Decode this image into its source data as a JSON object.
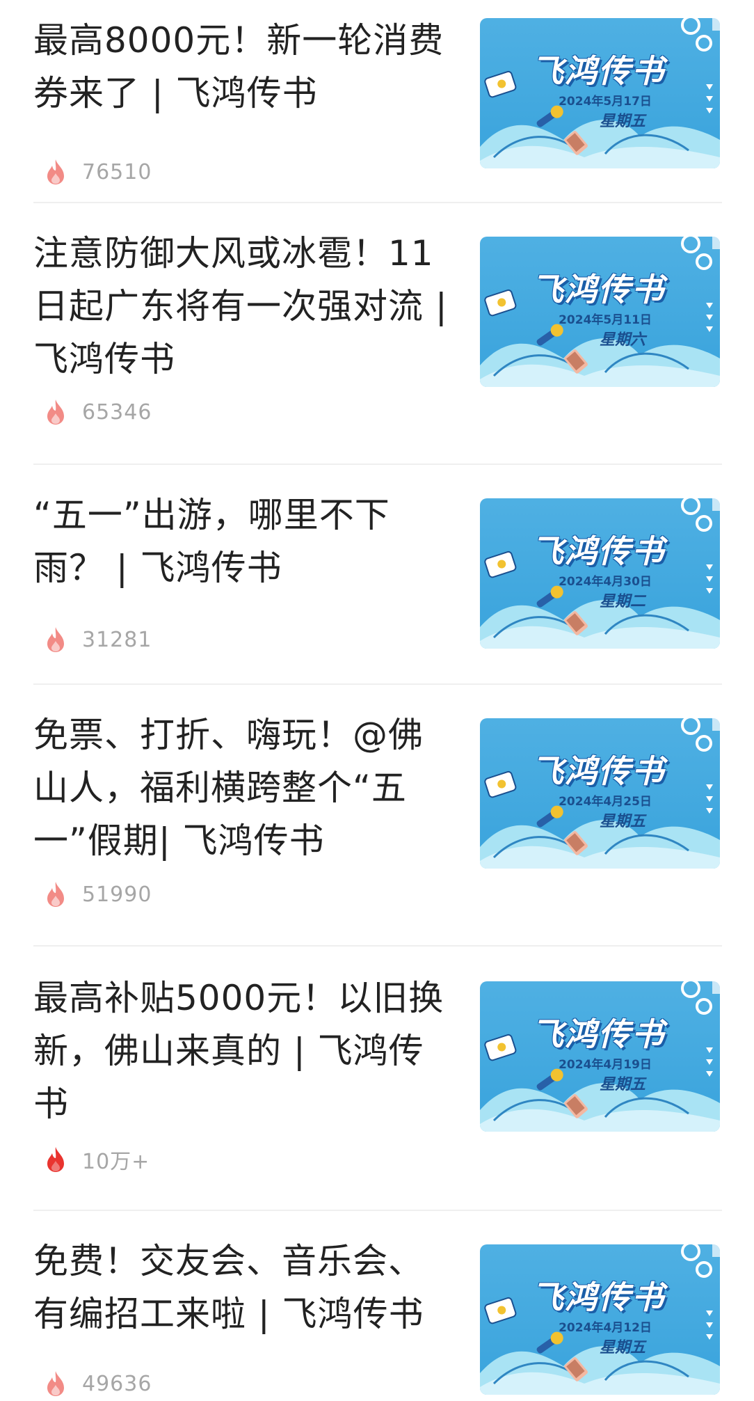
{
  "articles": [
    {
      "title": "最高8000元！新一轮消费券来了 | 飞鸿传书",
      "views": "76510",
      "hot": false,
      "thumb": {
        "brand": "飞鸿传书",
        "date": "2024年5月17日",
        "weekday": "星期五"
      }
    },
    {
      "title": "注意防御大风或冰雹！11日起广东将有一次强对流 | 飞鸿传书",
      "views": "65346",
      "hot": false,
      "thumb": {
        "brand": "飞鸿传书",
        "date": "2024年5月11日",
        "weekday": "星期六"
      }
    },
    {
      "title": "“五一”出游，哪里不下雨？ | 飞鸿传书",
      "views": "31281",
      "hot": false,
      "thumb": {
        "brand": "飞鸿传书",
        "date": "2024年4月30日",
        "weekday": "星期二"
      }
    },
    {
      "title": "免票、打折、嗨玩！@佛山人，福利横跨整个“五一”假期| 飞鸿传书",
      "views": "51990",
      "hot": false,
      "thumb": {
        "brand": "飞鸿传书",
        "date": "2024年4月25日",
        "weekday": "星期五"
      }
    },
    {
      "title": "最高补贴5000元！以旧换新，佛山来真的 | 飞鸿传书",
      "views": "10万+",
      "hot": true,
      "thumb": {
        "brand": "飞鸿传书",
        "date": "2024年4月19日",
        "weekday": "星期五"
      }
    },
    {
      "title": "免费！交友会、音乐会、有编招工来啦 | 飞鸿传书",
      "views": "49636",
      "hot": false,
      "thumb": {
        "brand": "飞鸿传书",
        "date": "2024年4月12日",
        "weekday": "星期五"
      }
    }
  ],
  "icons": {
    "views": "flame-icon"
  },
  "colors": {
    "flame_normal": "#f28b86",
    "flame_hot": "#e9342f",
    "count": "#a6a6a6",
    "title": "#222222",
    "thumb_bg": "#43a9df"
  }
}
